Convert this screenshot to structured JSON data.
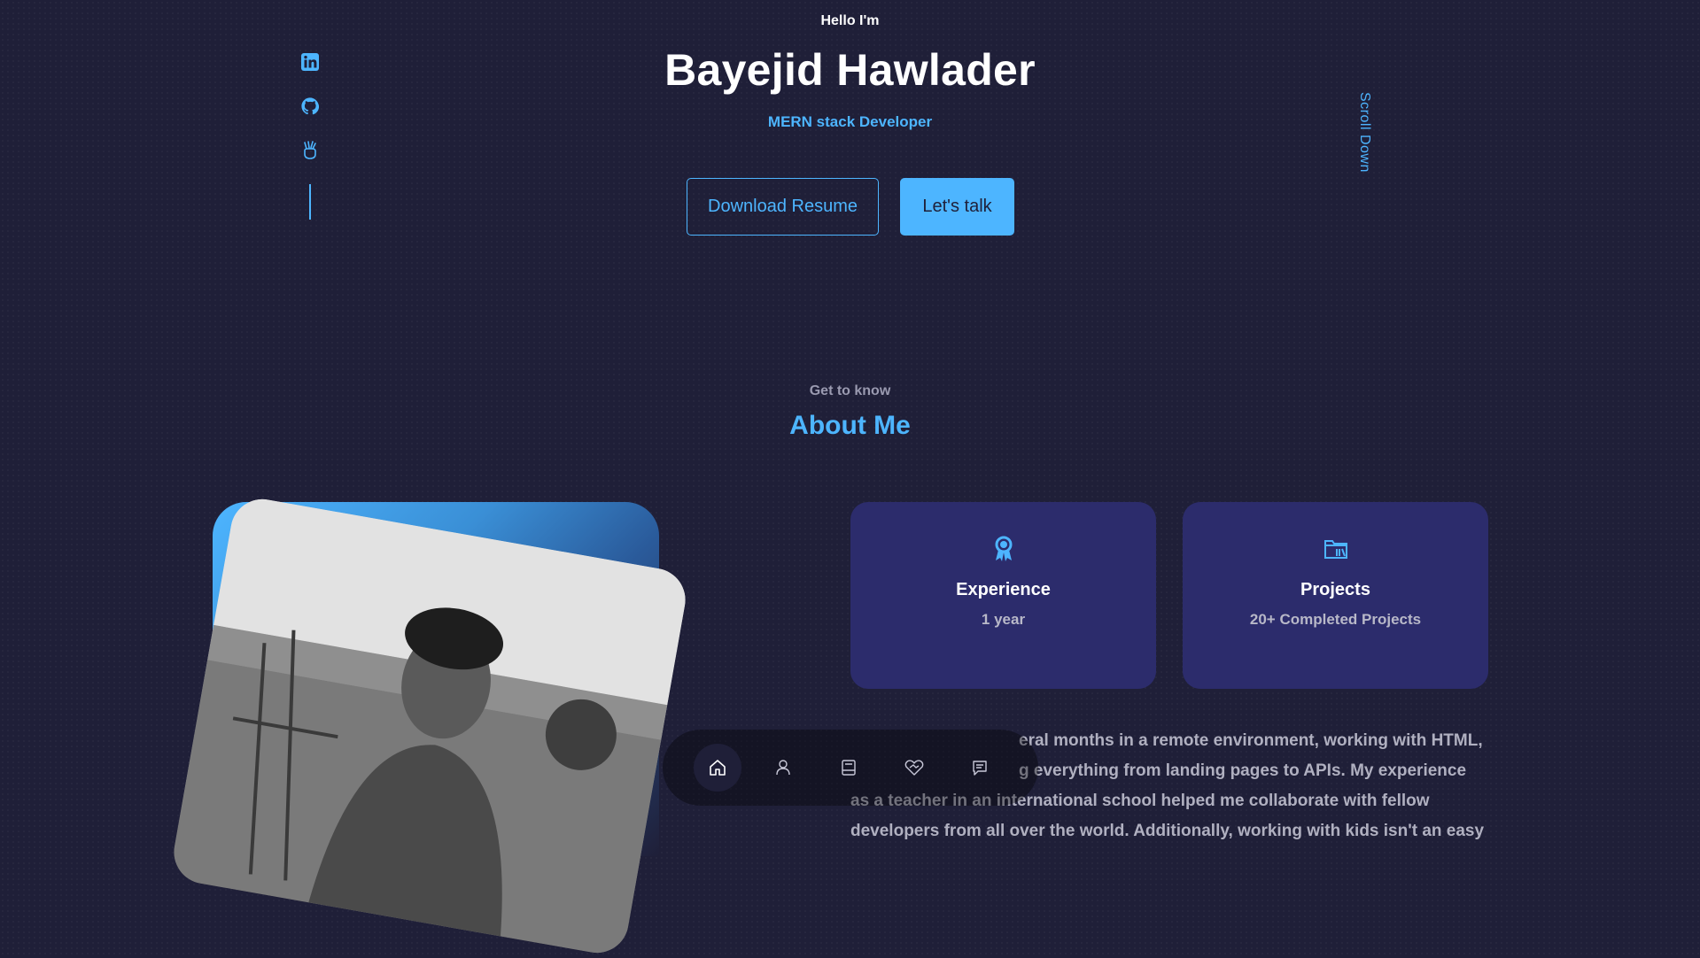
{
  "hero": {
    "greeting": "Hello I'm",
    "name": "Bayejid Hawlader",
    "role": "MERN stack Developer",
    "download_label": "Download Resume",
    "talk_label": "Let's talk",
    "scroll_label": "Scroll Down"
  },
  "socials": [
    {
      "icon": "linkedin-icon"
    },
    {
      "icon": "github-icon"
    },
    {
      "icon": "angellist-icon"
    }
  ],
  "about": {
    "kicker": "Get to know",
    "title": "About Me",
    "cards": [
      {
        "icon": "award-icon",
        "title": "Experience",
        "value": "1 year"
      },
      {
        "icon": "folder-library-icon",
        "title": "Projects",
        "value": "20+ Completed Projects"
      }
    ],
    "paragraph_lines": [
      "eral months in a remote environment, working with HTML,",
      "g everything from landing pages to APIs. My experience",
      "as a teacher in an international school helped me collaborate with fellow",
      "developers from all over the world. Additionally, working with kids isn't an easy"
    ]
  },
  "nav": [
    {
      "icon": "home-icon",
      "active": true
    },
    {
      "icon": "user-icon",
      "active": false
    },
    {
      "icon": "book-icon",
      "active": false
    },
    {
      "icon": "services-icon",
      "active": false
    },
    {
      "icon": "message-icon",
      "active": false
    }
  ],
  "colors": {
    "accent": "#4db5ff",
    "background": "#1f1f38",
    "card": "#2c2c6c"
  }
}
